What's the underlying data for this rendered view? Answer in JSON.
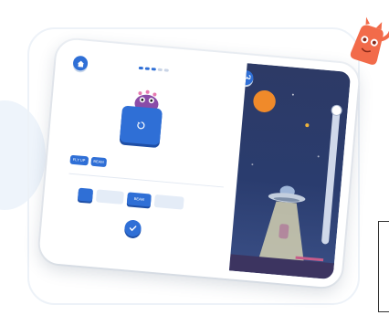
{
  "app": {
    "name": "coding puzzle tablet illustration"
  },
  "header": {
    "home_icon": "home-icon",
    "progress": {
      "completed": 3,
      "total": 5
    },
    "settings_icon": "wrench-icon"
  },
  "workspace": {
    "run_button_icon": "replay-icon",
    "available_blocks": [
      {
        "label": "FLY UP"
      },
      {
        "label": "BEAM"
      }
    ],
    "program_slots": [
      {
        "label": "",
        "filled": true
      },
      {
        "label": "",
        "filled": false
      },
      {
        "label": "BEAM",
        "filled": true
      },
      {
        "label": "",
        "filled": false
      }
    ],
    "submit_icon": "check-icon"
  },
  "scene": {
    "elements": [
      "moon",
      "ufo",
      "tractor-beam",
      "alien-figure",
      "stars"
    ],
    "slider_icon": "cursor-icon",
    "slider_value": 0.0
  },
  "colors": {
    "primary": "#2f6fd6",
    "sky_top": "#2d3a66",
    "moon": "#f08a2a",
    "mascot": "#f26b4a"
  }
}
